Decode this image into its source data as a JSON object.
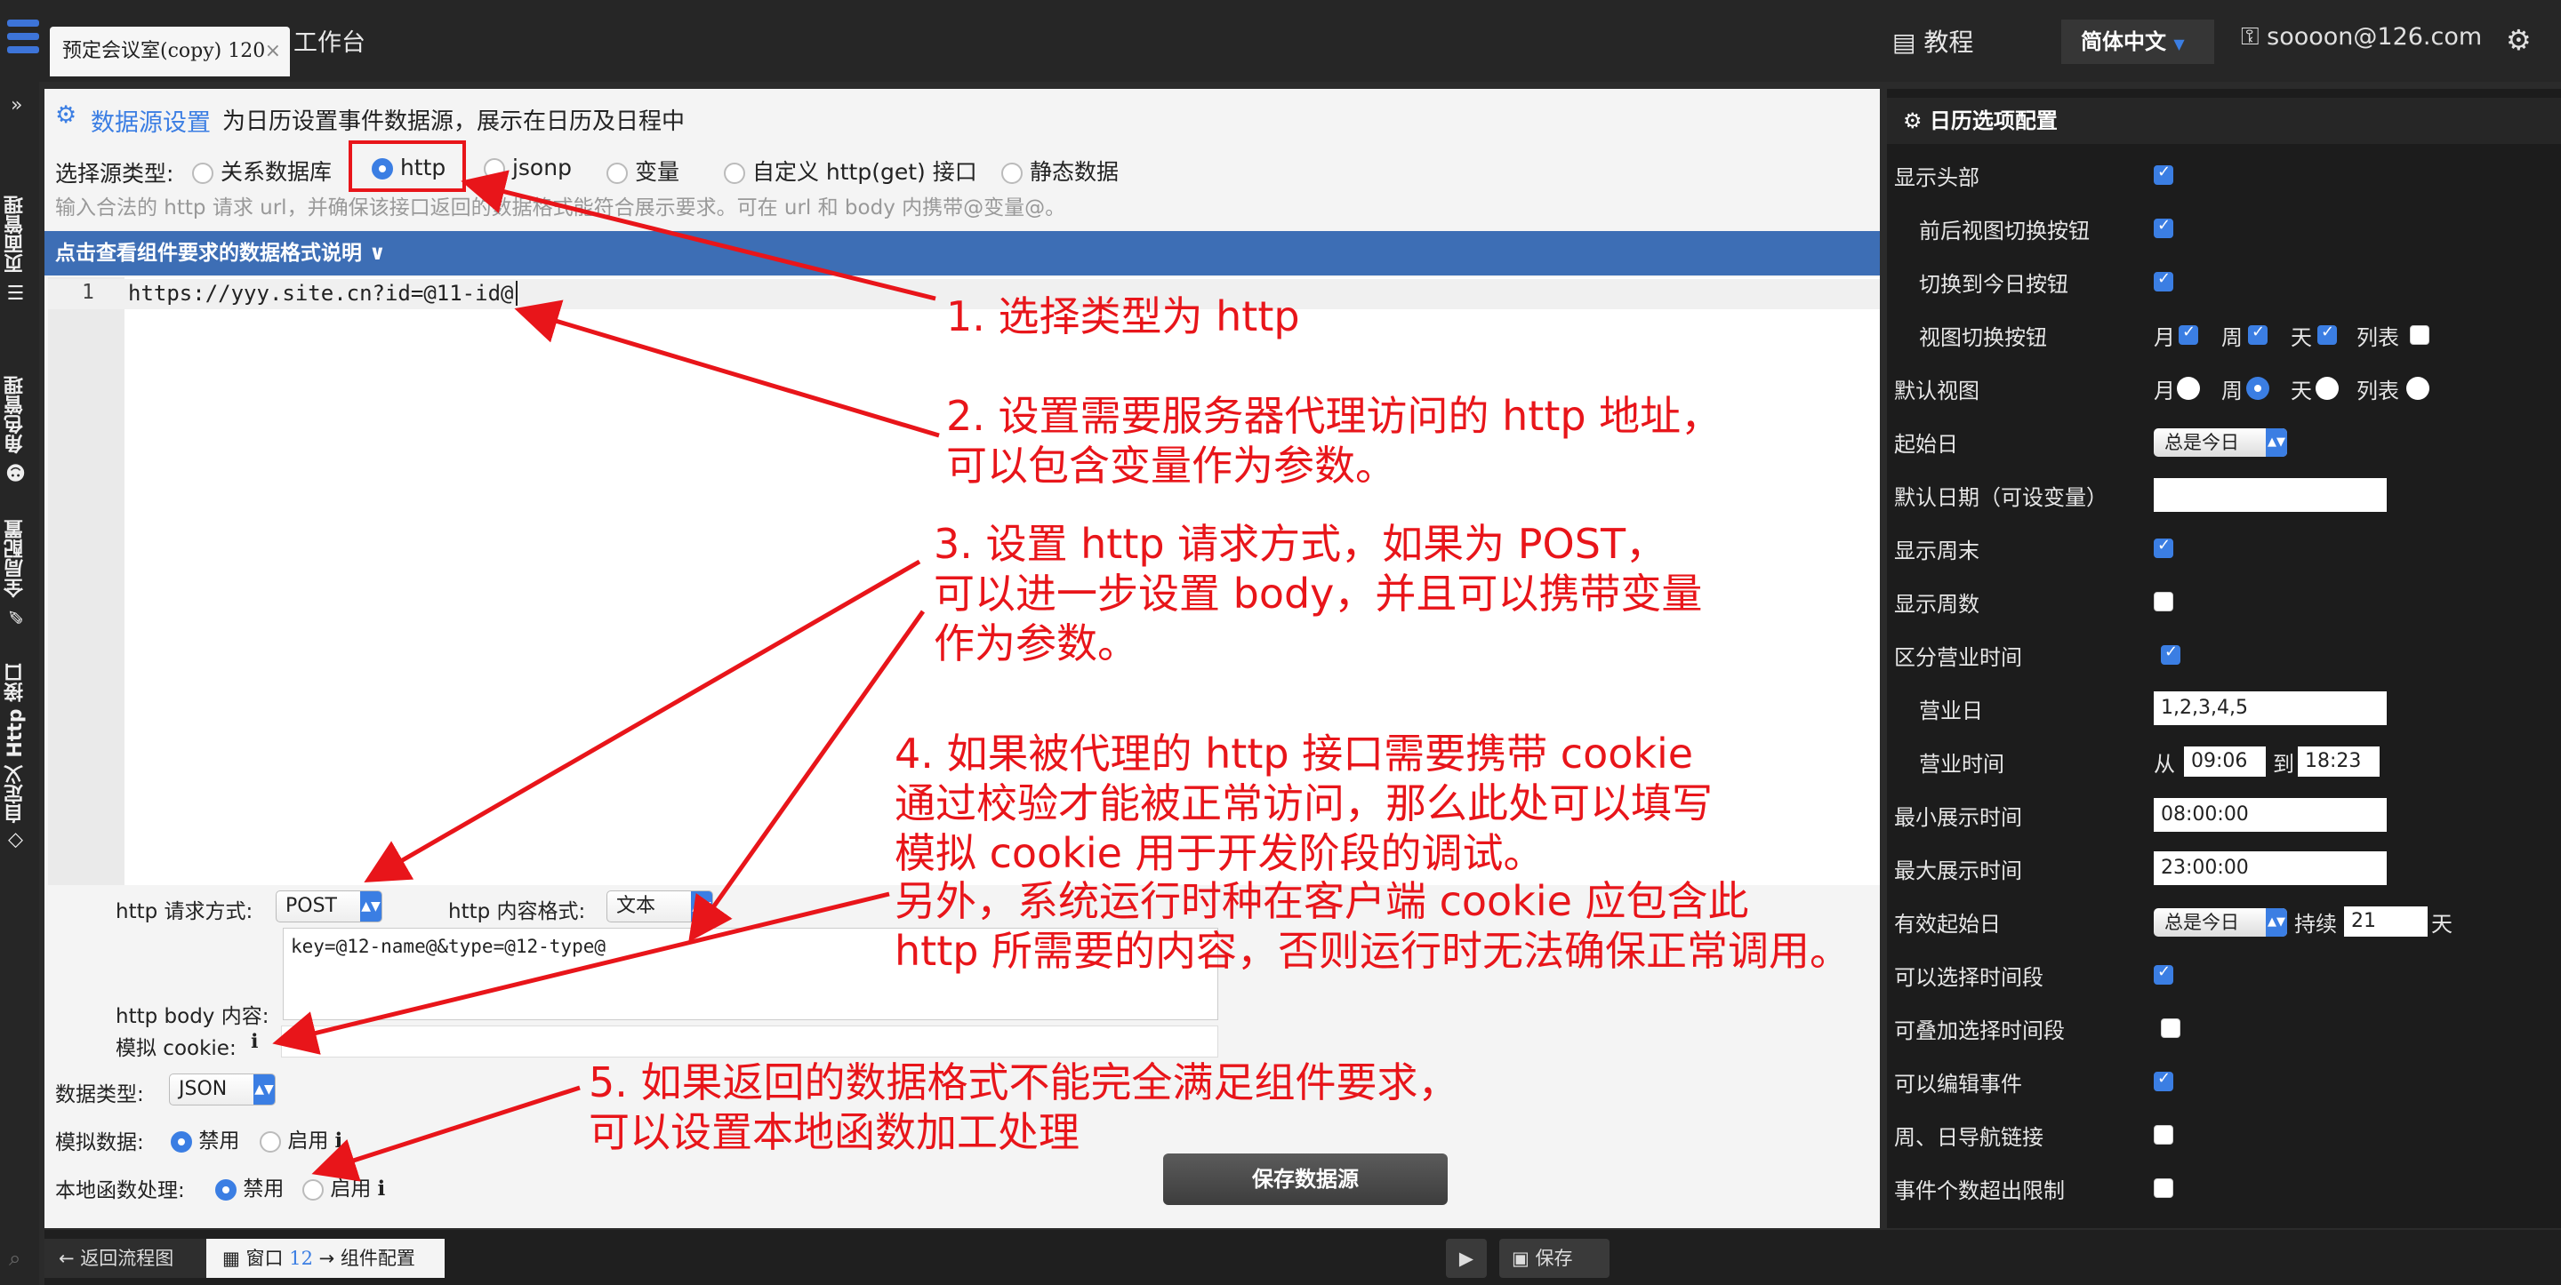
{
  "top": {
    "tab_title": "预定会议室(copy) 120",
    "tab_close": "×",
    "app_title": "工作台",
    "tutorial": "教程",
    "language": "简体中文",
    "user": "soooon@126.com"
  },
  "leftnav": {
    "collapse": "»",
    "items": [
      "页面管理",
      "角色管理",
      "全局配置",
      "自定义 Http 接口"
    ]
  },
  "datasource": {
    "title": "数据源设置",
    "subtitle": "为日历设置事件数据源，展示在日历及日程中",
    "type_label": "选择源类型:",
    "types": [
      "关系数据库",
      "http",
      "jsonp",
      "变量",
      "自定义 http(get) 接口",
      "静态数据"
    ],
    "selected_type": "http",
    "hint": "输入合法的 http 请求 url，并确保该接口返回的数据格式能符合展示要求。可在 url 和 body 内携带@变量@。",
    "format_bar": "点击查看组件要求的数据格式说明 ∨",
    "line_number": "1",
    "url": "https://yyy.site.cn?id=@11-id@",
    "method_label": "http 请求方式:",
    "method": "POST",
    "content_format_label": "http 内容格式:",
    "content_format": "文本",
    "body": "key=@12-name@&type=@12-type@",
    "body_label": "http body 内容:",
    "cookie_label": "模拟 cookie:",
    "cookie_value": "",
    "data_type_label": "数据类型:",
    "data_type": "JSON",
    "mock_label": "模拟数据:",
    "disabled": "禁用",
    "enabled": "启用",
    "local_fn_label": "本地函数处理:",
    "save": "保存数据源"
  },
  "bottombar": {
    "back": "返回流程图",
    "window": "窗口",
    "window_num": "12",
    "component_config": "组件配置",
    "save": "保存"
  },
  "calendar": {
    "header": "日历选项配置",
    "show_header": "显示头部",
    "prev_next": "前后视图切换按钮",
    "today": "切换到今日按钮",
    "view_switch": "视图切换按钮",
    "month": "月",
    "week": "周",
    "day": "天",
    "list": "列表",
    "default_view": "默认视图",
    "start_day": "起始日",
    "start_day_value": "总是今日",
    "default_date": "默认日期（可设变量）",
    "show_weekend": "显示周末",
    "show_weeknum": "显示周数",
    "business_hours": "区分营业时间",
    "business_days": "营业日",
    "business_days_value": "1,2,3,4,5",
    "business_time": "营业时间",
    "from": "从",
    "to": "到",
    "time_from": "09:06",
    "time_to": "18:23",
    "min_time": "最小展示时间",
    "min_time_value": "08:00:00",
    "max_time": "最大展示时间",
    "max_time_value": "23:00:00",
    "valid_start": "有效起始日",
    "valid_start_value": "总是今日",
    "duration": "持续",
    "duration_value": "21",
    "days_unit": "天",
    "selectable": "可以选择时间段",
    "overlap": "可叠加选择时间段",
    "editable": "可以编辑事件",
    "nav_links": "周、日导航链接",
    "event_limit": "事件个数超出限制"
  },
  "annotations": {
    "a1": "1. 选择类型为 http",
    "a2_1": "2. 设置需要服务器代理访问的 http 地址，",
    "a2_2": "可以包含变量作为参数。",
    "a3_1": "3. 设置 http 请求方式，如果为 POST，",
    "a3_2": "可以进一步设置 body，并且可以携带变量",
    "a3_3": "作为参数。",
    "a4_1": "4. 如果被代理的 http 接口需要携带 cookie",
    "a4_2": "通过校验才能被正常访问，那么此处可以填写",
    "a4_3": "模拟 cookie 用于开发阶段的调试。",
    "a4_4": "另外，系统运行时种在客户端 cookie 应包含此",
    "a4_5": "http 所需要的内容，否则运行时无法确保正常调用。",
    "a5_1": "5. 如果返回的数据格式不能完全满足组件要求，",
    "a5_2": "可以设置本地函数加工处理"
  },
  "colors": {
    "accent": "#3b7ee3",
    "annotation": "#e8151a",
    "bar": "#3d6eb5"
  }
}
